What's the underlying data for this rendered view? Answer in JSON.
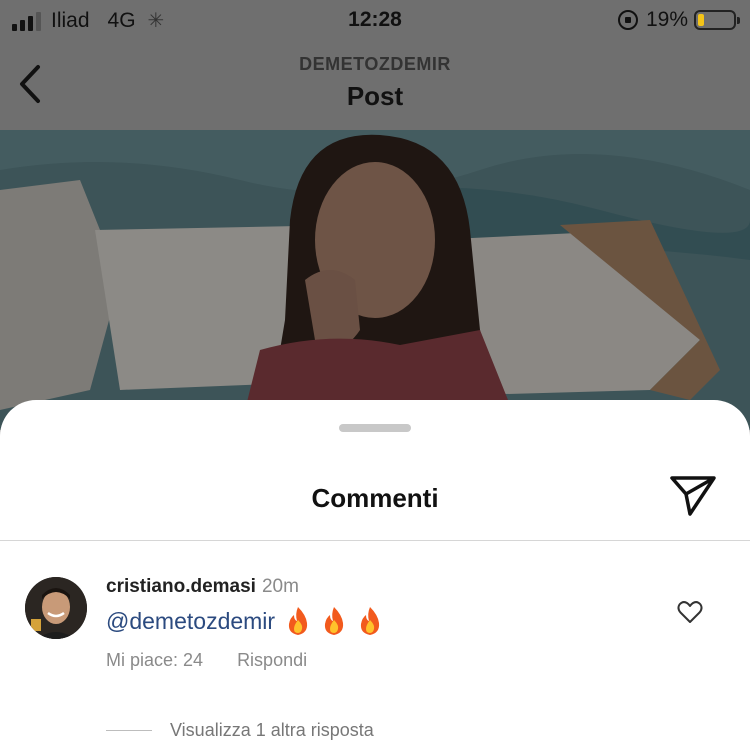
{
  "status_bar": {
    "carrier": "Iliad",
    "network": "4G",
    "time": "12:28",
    "battery_percent": "19%",
    "battery_level": 0.19,
    "battery_color": "#f3c318"
  },
  "nav": {
    "account": "DEMETOZDEMIR",
    "title": "Post",
    "back_icon": "chevron-left-icon"
  },
  "sheet": {
    "title": "Commenti",
    "send_icon": "paper-plane-icon"
  },
  "comment": {
    "username": "cristiano.demasi",
    "time": "20m",
    "mention": "@demetozdemir",
    "emojis": [
      "fire",
      "fire",
      "fire"
    ],
    "likes_label": "Mi piace: 24",
    "reply_label": "Rispondi",
    "like_icon": "heart-outline-icon"
  },
  "replies": {
    "view_more_label": "Visualizza 1 altra risposta"
  },
  "colors": {
    "mention": "#2b4a7f",
    "meta_text": "#8a8a8a"
  }
}
